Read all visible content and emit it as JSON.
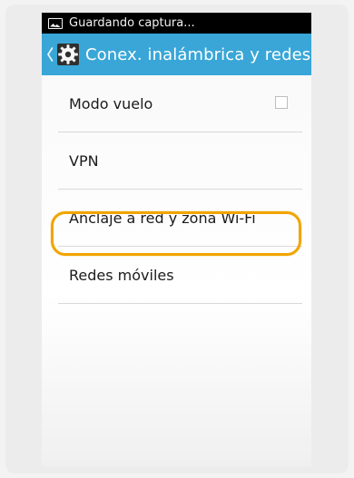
{
  "status_bar": {
    "notification_text": "Guardando captura...",
    "icon": "screenshot-icon"
  },
  "action_bar": {
    "title": "Conex. inalámbrica y redes",
    "back_icon": "chevron-left-icon",
    "settings_icon": "gear-icon",
    "background_color": "#39a6d7"
  },
  "settings_list": {
    "items": [
      {
        "label": "Modo vuelo",
        "has_checkbox": true,
        "checked": false
      },
      {
        "label": "VPN",
        "has_checkbox": false
      },
      {
        "label": "Anclaje a red y zona Wi-Fi",
        "has_checkbox": false
      },
      {
        "label": "Redes móviles",
        "has_checkbox": false,
        "highlighted": true
      }
    ]
  },
  "highlight": {
    "color": "#f1a400"
  }
}
